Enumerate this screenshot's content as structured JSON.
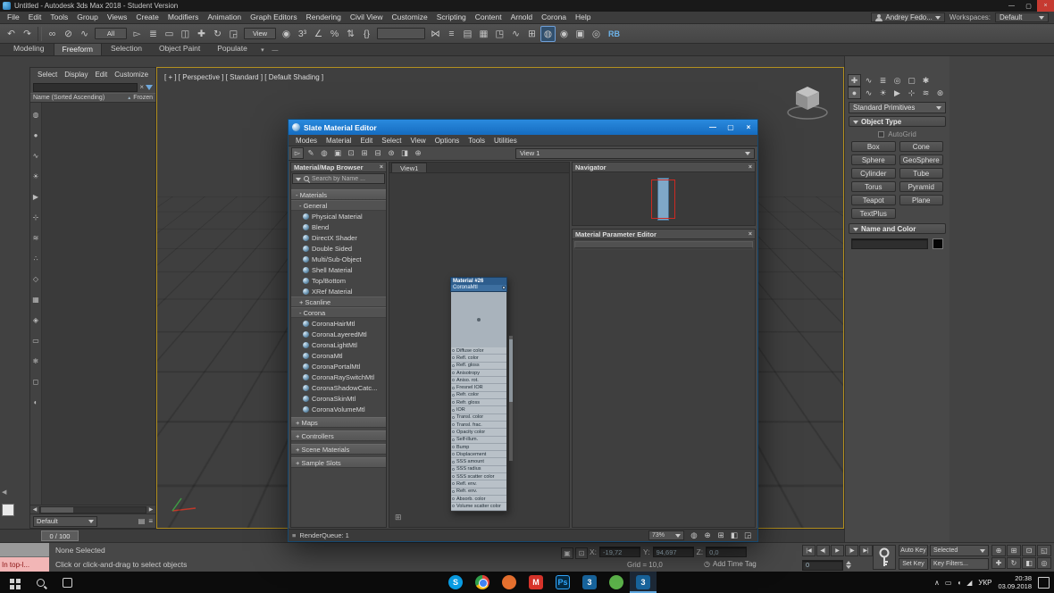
{
  "colors": {
    "accent_blue": "#1779cf",
    "viewport_border": "#b3901f",
    "node_header_blue": "#2d5d8d",
    "close_red": "#c63a31",
    "listener_pink": "#f2b6b6",
    "navigator_view_red": "#cc2a22"
  },
  "glyphs": {
    "close": "×",
    "sort": "▲",
    "left": "◀",
    "right": "▶",
    "pan": "⊞",
    "menu": "≡"
  },
  "titlebar": {
    "title": "Untitled - Autodesk 3ds Max 2018 - Student Version",
    "window_buttons": [
      {
        "n": "minimize-button",
        "g": "—",
        "c": ""
      },
      {
        "n": "maximize-button",
        "g": "▢",
        "c": ""
      },
      {
        "n": "close-button",
        "g": "×",
        "c": "close"
      }
    ]
  },
  "menubar": {
    "items": [
      "File",
      "Edit",
      "Tools",
      "Group",
      "Views",
      "Create",
      "Modifiers",
      "Animation",
      "Graph Editors",
      "Rendering",
      "Civil View",
      "Customize",
      "Scripting",
      "Content",
      "Arnold",
      "Corona",
      "Help"
    ],
    "user": "Andrey Fedo...",
    "workspace_label": "Workspaces:",
    "workspace_value": "Default"
  },
  "toolbar": {
    "items": [
      {
        "t": "i",
        "n": "undo-icon",
        "g": "↶"
      },
      {
        "t": "i",
        "n": "redo-icon",
        "g": "↷"
      },
      {
        "t": "s",
        "n": "toolbar-separator",
        "g": ""
      },
      {
        "t": "i",
        "n": "select-and-link-icon",
        "g": "∞"
      },
      {
        "t": "i",
        "n": "unlink-selection-icon",
        "g": "⊘"
      },
      {
        "t": "i",
        "n": "bind-to-space-warp-icon",
        "g": "∿"
      },
      {
        "t": "d",
        "n": "selection-filter-dropdown",
        "g": "All"
      },
      {
        "t": "i",
        "n": "select-object-icon",
        "g": "▻"
      },
      {
        "t": "i",
        "n": "select-by-name-icon",
        "g": "≣"
      },
      {
        "t": "i",
        "n": "rectangular-selection-region-icon",
        "g": "▭"
      },
      {
        "t": "i",
        "n": "window-crossing-toggle-icon",
        "g": "◫"
      },
      {
        "t": "i",
        "n": "select-and-move-icon",
        "g": "✚"
      },
      {
        "t": "i",
        "n": "select-and-rotate-icon",
        "g": "↻"
      },
      {
        "t": "i",
        "n": "select-and-scale-icon",
        "g": "◲"
      },
      {
        "t": "d",
        "n": "reference-coordinate-dropdown",
        "g": "View"
      },
      {
        "t": "i",
        "n": "use-pivot-center-icon",
        "g": "◉"
      },
      {
        "t": "i",
        "n": "snap-toggle-icon",
        "g": "3³"
      },
      {
        "t": "i",
        "n": "angle-snap-icon",
        "g": "∠"
      },
      {
        "t": "i",
        "n": "percent-snap-icon",
        "g": "%"
      },
      {
        "t": "i",
        "n": "spinner-snap-icon",
        "g": "⇅"
      },
      {
        "t": "i",
        "n": "edit-named-selection-sets-icon",
        "g": "{}"
      },
      {
        "t": "d wide",
        "n": "named-selection-sets-dropdown",
        "g": ""
      },
      {
        "t": "i",
        "n": "mirror-icon",
        "g": "⋈"
      },
      {
        "t": "i",
        "n": "align-icon",
        "g": "≡"
      },
      {
        "t": "i",
        "n": "toggle-scene-explorer-icon",
        "g": "▤"
      },
      {
        "t": "i",
        "n": "toggle-layer-explorer-icon",
        "g": "▦"
      },
      {
        "t": "i",
        "n": "toggle-ribbon-icon",
        "g": "◳"
      },
      {
        "t": "i",
        "n": "curve-editor-icon",
        "g": "∿"
      },
      {
        "t": "i",
        "n": "schematic-view-icon",
        "g": "⊞"
      },
      {
        "t": "i on",
        "n": "material-editor-icon",
        "g": "◍"
      },
      {
        "t": "i",
        "n": "render-setup-icon",
        "g": "◉"
      },
      {
        "t": "i",
        "n": "rendered-frame-window-icon",
        "g": "▣"
      },
      {
        "t": "i",
        "n": "render-production-icon",
        "g": "◎"
      },
      {
        "t": "i rb",
        "n": "rb-plugin-button",
        "g": "RB"
      }
    ]
  },
  "ribbon": {
    "tabs": [
      {
        "label": "Modeling",
        "state": ""
      },
      {
        "label": "Freeform",
        "state": "on"
      },
      {
        "label": "Selection",
        "state": ""
      },
      {
        "label": "Object Paint",
        "state": ""
      },
      {
        "label": "Populate",
        "state": ""
      }
    ],
    "controls": [
      {
        "n": "ribbon-expand-icon",
        "g": "▾"
      },
      {
        "n": "ribbon-minimize-icon",
        "g": "—"
      }
    ]
  },
  "scene_explorer": {
    "menus": [
      "Select",
      "Display",
      "Edit",
      "Customize"
    ],
    "name_header": "Name (Sorted Ascending)",
    "frozen_header": "Frozen",
    "footer_dropdown": "Default",
    "filter_icons": [
      {
        "n": "display-everything-icon",
        "g": "◍"
      },
      {
        "n": "display-geometry-icon",
        "g": "●"
      },
      {
        "n": "display-shapes-icon",
        "g": "∿"
      },
      {
        "n": "display-lights-icon",
        "g": "☀"
      },
      {
        "n": "display-cameras-icon",
        "g": "▶"
      },
      {
        "n": "display-helpers-icon",
        "g": "⊹"
      },
      {
        "n": "display-space-warps-icon",
        "g": "≋"
      },
      {
        "n": "display-particles-icon",
        "g": "∴"
      },
      {
        "n": "display-bones-icon",
        "g": "◇"
      },
      {
        "n": "display-groups-icon",
        "g": "▦"
      },
      {
        "n": "display-xrefs-icon",
        "g": "◈"
      },
      {
        "n": "display-selection-sets-icon",
        "g": "▭"
      },
      {
        "n": "display-frozen-icon",
        "g": "❄"
      },
      {
        "n": "display-hidden-icon",
        "g": "◻"
      },
      {
        "n": "display-materials-icon",
        "g": "◐"
      }
    ],
    "footer_icons": [
      {
        "n": "explorer-lock-icon",
        "g": "▤"
      },
      {
        "n": "explorer-menu-icon",
        "g": "≡"
      }
    ],
    "dock_icons": [
      {
        "n": "collapse-arrow-icon",
        "g": "◀",
        "c": ""
      },
      {
        "n": "floating-panel-icon",
        "g": "",
        "c": "white"
      }
    ]
  },
  "viewport": {
    "label": "[ + ] [ Perspective ] [ Standard ] [ Default Shading ]"
  },
  "command_panel": {
    "tabs_row1": [
      {
        "n": "create-tab-icon",
        "g": "✚",
        "c": "on"
      },
      {
        "n": "modify-tab-icon",
        "g": "∿",
        "c": ""
      },
      {
        "n": "hierarchy-tab-icon",
        "g": "≣",
        "c": ""
      },
      {
        "n": "motion-tab-icon",
        "g": "◎",
        "c": ""
      },
      {
        "n": "display-tab-icon",
        "g": "▢",
        "c": ""
      },
      {
        "n": "utilities-tab-icon",
        "g": "✱",
        "c": ""
      }
    ],
    "tabs_row2": [
      {
        "n": "geometry-category-icon",
        "g": "●",
        "c": "on"
      },
      {
        "n": "shapes-category-icon",
        "g": "∿",
        "c": ""
      },
      {
        "n": "lights-category-icon",
        "g": "☀",
        "c": ""
      },
      {
        "n": "cameras-category-icon",
        "g": "▶",
        "c": ""
      },
      {
        "n": "helpers-category-icon",
        "g": "⊹",
        "c": ""
      },
      {
        "n": "space-warps-category-icon",
        "g": "≋",
        "c": ""
      },
      {
        "n": "systems-category-icon",
        "g": "⊛",
        "c": ""
      }
    ],
    "category_dropdown": "Standard Primitives",
    "object_type_header": "Object Type",
    "autogrid_label": "AutoGrid",
    "buttons": [
      "Box",
      "Cone",
      "Sphere",
      "GeoSphere",
      "Cylinder",
      "Tube",
      "Torus",
      "Pyramid",
      "Teapot",
      "Plane",
      "TextPlus"
    ],
    "name_color_header": "Name and Color"
  },
  "slate": {
    "title": "Slate Material Editor",
    "window_buttons": [
      {
        "n": "slate-minimize-button",
        "g": "—"
      },
      {
        "n": "slate-maximize-button",
        "g": "▢"
      },
      {
        "n": "slate-close-button",
        "g": "×"
      }
    ],
    "menus": [
      "Modes",
      "Material",
      "Edit",
      "Select",
      "View",
      "Options",
      "Tools",
      "Utilities"
    ],
    "toolbar_icons": [
      {
        "n": "select-tool-icon",
        "g": "▻",
        "c": "on"
      },
      {
        "n": "pick-material-from-object-icon",
        "g": "✎",
        "c": ""
      },
      {
        "n": "assign-material-to-selection-icon",
        "g": "◍",
        "c": ""
      },
      {
        "n": "show-map-in-viewport-icon",
        "g": "▣",
        "c": ""
      },
      {
        "n": "show-end-result-icon",
        "g": "⊡",
        "c": ""
      },
      {
        "n": "layout-all-icon",
        "g": "⊞",
        "c": ""
      },
      {
        "n": "layout-children-icon",
        "g": "⊟",
        "c": ""
      },
      {
        "n": "material-id-channel-icon",
        "g": "⊛",
        "c": ""
      },
      {
        "n": "select-by-material-icon",
        "g": "◨",
        "c": ""
      },
      {
        "n": "zoom-tool-icon",
        "g": "⊕",
        "c": ""
      }
    ],
    "view_dropdown": "View 1",
    "browser": {
      "title": "Material/Map Browser",
      "search_placeholder": "Search by Name ...",
      "rows": [
        {
          "k": "sec",
          "label": "- Materials"
        },
        {
          "k": "sub",
          "label": "- General"
        },
        {
          "k": "item",
          "label": "Physical Material"
        },
        {
          "k": "item",
          "label": "Blend"
        },
        {
          "k": "item",
          "label": "DirectX Shader"
        },
        {
          "k": "item",
          "label": "Double Sided"
        },
        {
          "k": "item",
          "label": "Multi/Sub-Object"
        },
        {
          "k": "item",
          "label": "Shell Material"
        },
        {
          "k": "item",
          "label": "Top/Bottom"
        },
        {
          "k": "item",
          "label": "XRef Material"
        },
        {
          "k": "sub",
          "label": "+ Scanline"
        },
        {
          "k": "sub",
          "label": "- Corona"
        },
        {
          "k": "item",
          "label": "CoronaHairMtl"
        },
        {
          "k": "item",
          "label": "CoronaLayeredMtl"
        },
        {
          "k": "item",
          "label": "CoronaLightMtl"
        },
        {
          "k": "item",
          "label": "CoronaMtl"
        },
        {
          "k": "item",
          "label": "CoronaPortalMtl"
        },
        {
          "k": "item",
          "label": "CoronaRaySwitchMtl"
        },
        {
          "k": "item",
          "label": "CoronaShadowCatc..."
        },
        {
          "k": "item",
          "label": "CoronaSkinMtl"
        },
        {
          "k": "item",
          "label": "CoronaVolumeMtl"
        },
        {
          "k": "sec",
          "label": "+ Maps"
        },
        {
          "k": "sec",
          "label": "+ Controllers"
        },
        {
          "k": "sec",
          "label": "+ Scene Materials"
        },
        {
          "k": "sec",
          "label": "+ Sample Slots"
        }
      ]
    },
    "tab": "View1",
    "node": {
      "title": "Material #26",
      "type": "CoronaMtl",
      "slots": [
        "Diffuse color",
        "Refl. color",
        "Refl. gloss",
        "Anisotropy",
        "Aniso. rot.",
        "Fresnel IOR",
        "Refr. color",
        "Refr. gloss",
        "IOR",
        "Transl. color",
        "Transl. frac.",
        "Opacity color",
        "Self-illum.",
        "Bump",
        "Displacement",
        "SSS amount",
        "SSS radius",
        "SSS scatter color",
        "Refl. env.",
        "Refr. env.",
        "Absorb. color",
        "Volume scatter color"
      ]
    },
    "navigator": {
      "title": "Navigator"
    },
    "params": {
      "title": "Material Parameter Editor"
    },
    "render_queue": "RenderQueue: 1",
    "zoom": "73%",
    "bottom_icons": [
      {
        "n": "sample-quality-icon",
        "g": "◍"
      },
      {
        "n": "zoom-view-icon",
        "g": "⊕"
      },
      {
        "n": "zoom-extents-view-icon",
        "g": "⊞"
      },
      {
        "n": "pan-mode-icon",
        "g": "◧"
      },
      {
        "n": "maximize-view-icon",
        "g": "◲"
      }
    ]
  },
  "trackbar": {
    "label": "0 / 100"
  },
  "statusbar": {
    "listener_text": "In top-l...",
    "selection": "None Selected",
    "prompt": "Click or click-and-drag to select objects",
    "isolate_icons": [
      {
        "n": "isolate-selection-toggle-icon",
        "g": "▣"
      },
      {
        "n": "selection-lock-toggle-icon",
        "g": "⊡"
      }
    ],
    "x_label": "X:",
    "x_value": "-19,72",
    "y_label": "Y:",
    "y_value": "94,697",
    "z_label": "Z:",
    "z_value": "0,0",
    "grid_label": "Grid = 10,0",
    "time_tag_icon": "◷",
    "add_time_tag": "Add Time Tag"
  },
  "animation": {
    "playback": [
      {
        "n": "go-to-start-icon",
        "g": "|◀"
      },
      {
        "n": "previous-frame-icon",
        "g": "◀|"
      },
      {
        "n": "play-icon",
        "g": "▶"
      },
      {
        "n": "next-frame-icon",
        "g": "|▶"
      },
      {
        "n": "go-to-end-icon",
        "g": "▶|"
      }
    ],
    "frame_value": "0",
    "auto_key": "Auto Key",
    "selected": "Selected",
    "set_key": "Set Key",
    "key_filters": "Key Filters...",
    "nav_icons": [
      {
        "n": "zoom-icon",
        "g": "⊕"
      },
      {
        "n": "zoom-all-icon",
        "g": "⊞"
      },
      {
        "n": "zoom-extents-icon",
        "g": "⊡"
      },
      {
        "n": "zoom-region-icon",
        "g": "◱"
      },
      {
        "n": "pan-icon",
        "g": "✚"
      },
      {
        "n": "orbit-icon",
        "g": "↻"
      },
      {
        "n": "maximize-viewport-icon",
        "g": "◧"
      },
      {
        "n": "field-of-view-icon",
        "g": "◎"
      }
    ]
  },
  "taskbar": {
    "apps": [
      {
        "n": "taskbar-skype-icon",
        "g": "S",
        "c": "#0a9ee5",
        "s": "circle",
        "st": ""
      },
      {
        "n": "taskbar-chrome-icon",
        "g": "",
        "c": "",
        "s": "chrome",
        "st": ""
      },
      {
        "n": "taskbar-firefox-icon",
        "g": "",
        "c": "#e8712f",
        "s": "circle",
        "st": ""
      },
      {
        "n": "taskbar-mail-icon",
        "g": "M",
        "c": "#d9342b",
        "s": "square",
        "st": ""
      },
      {
        "n": "taskbar-photoshop-icon",
        "g": "Ps",
        "c": "#052b44",
        "s": "square ps",
        "st": ""
      },
      {
        "n": "taskbar-3dsmax-icon",
        "g": "3",
        "c": "#18649c",
        "s": "square",
        "st": ""
      },
      {
        "n": "taskbar-corona-icon",
        "g": "",
        "c": "#5cb24a",
        "s": "circle",
        "st": ""
      },
      {
        "n": "taskbar-3dsmax-active-icon",
        "g": "3",
        "c": "#18649c",
        "s": "square",
        "st": "on"
      }
    ],
    "tray_icons": [
      {
        "n": "tray-expand-icon",
        "g": "∧"
      },
      {
        "n": "tray-display-icon",
        "g": "▭"
      },
      {
        "n": "tray-volume-icon",
        "g": "◖"
      },
      {
        "n": "tray-network-icon",
        "g": "◢"
      }
    ],
    "lang": "УКР",
    "time": "20:38",
    "date": "03.09.2018"
  }
}
